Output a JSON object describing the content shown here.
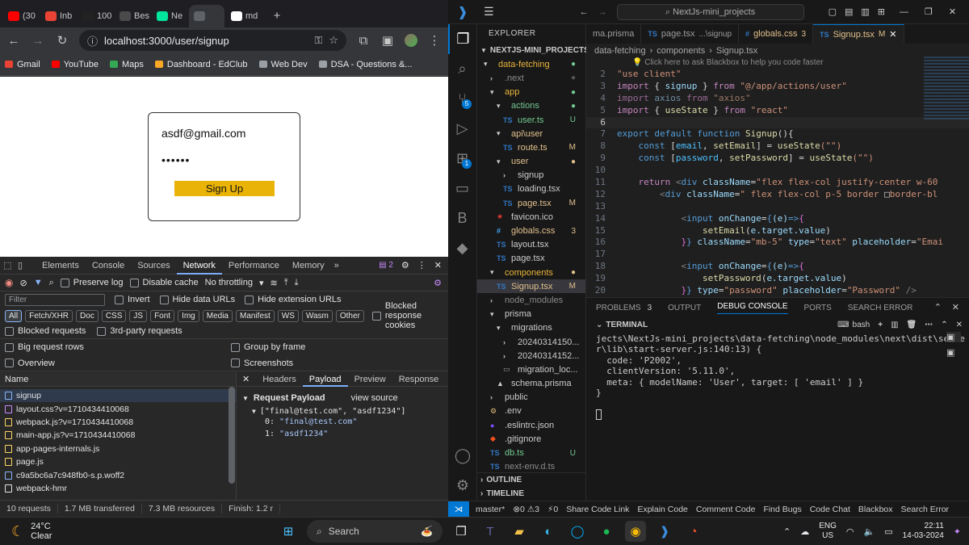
{
  "browser": {
    "tabs": [
      {
        "label": "(30",
        "icon": "youtube-icon",
        "color": "#ff0000"
      },
      {
        "label": "Inb",
        "icon": "gmail-icon",
        "color": "#ea4335"
      },
      {
        "label": "100",
        "icon": "triangle-icon",
        "color": "#222222"
      },
      {
        "label": "Bes",
        "icon": "a-logo-icon",
        "color": "#4a4a4a"
      },
      {
        "label": "Ne",
        "icon": "neon-icon",
        "color": "#00e599"
      },
      {
        "label": "",
        "icon": "globe-icon",
        "color": "#5f6368"
      },
      {
        "label": "md",
        "icon": "github-icon",
        "color": "#ffffff"
      }
    ],
    "new_tab": "+",
    "url": "localhost:3000/user/signup",
    "bookmarks": [
      {
        "label": "Gmail",
        "color": "#ea4335"
      },
      {
        "label": "YouTube",
        "color": "#ff0000"
      },
      {
        "label": "Maps",
        "color": "#34a853"
      },
      {
        "label": "Dashboard - EdClub",
        "color": "#f9a825"
      },
      {
        "label": "Web Dev",
        "color": "#9aa0a6"
      },
      {
        "label": "DSA - Questions &...",
        "color": "#9aa0a6"
      }
    ]
  },
  "page": {
    "email_value": "asdf@gmail.com",
    "password_value": "••••••",
    "signup_label": "Sign Up",
    "accent": "#eab308"
  },
  "devtools": {
    "tabs": [
      "Elements",
      "Console",
      "Sources",
      "Network",
      "Performance",
      "Memory"
    ],
    "issues_count": "2",
    "preserve_log": "Preserve log",
    "disable_cache": "Disable cache",
    "throttling": "No throttling",
    "filter_placeholder": "Filter",
    "invert": "Invert",
    "hide_data_urls": "Hide data URLs",
    "hide_ext_urls": "Hide extension URLs",
    "chips": [
      "All",
      "Fetch/XHR",
      "Doc",
      "CSS",
      "JS",
      "Font",
      "Img",
      "Media",
      "Manifest",
      "WS",
      "Wasm",
      "Other"
    ],
    "blocked_cookies": "Blocked response cookies",
    "blocked_requests": "Blocked requests",
    "third_party": "3rd-party requests",
    "big_rows": "Big request rows",
    "group_frame": "Group by frame",
    "overview": "Overview",
    "screenshots": "Screenshots",
    "name_header": "Name",
    "requests": [
      "signup",
      "layout.css?v=1710434410068",
      "webpack.js?v=1710434410068",
      "main-app.js?v=1710434410068",
      "app-pages-internals.js",
      "page.js",
      "c9a5bc6a7c948fb0-s.p.woff2",
      "webpack-hmr"
    ],
    "detail_tabs": [
      "Headers",
      "Payload",
      "Preview",
      "Response"
    ],
    "payload_title": "Request Payload",
    "view_source": "view source",
    "payload_array": "[\"final@test.com\", \"asdf1234\"]",
    "payload_items": [
      {
        "k": "0:",
        "v": "\"final@test.com\""
      },
      {
        "k": "1:",
        "v": "\"asdf1234\""
      }
    ],
    "status": [
      "10 requests",
      "1.7 MB transferred",
      "7.3 MB resources",
      "Finish: 1.2 r"
    ]
  },
  "vscode": {
    "search": "NextJs-mini_projects",
    "explorer_title": "EXPLORER",
    "project": "NEXTJS-MINI_PROJECTS",
    "tree": [
      {
        "d": 1,
        "t": "fo",
        "n": "data-fetching",
        "c": "#e8b43a",
        "s": "●",
        "sc": "#73c991"
      },
      {
        "d": 2,
        "t": "fc",
        "n": ".next",
        "c": "#8a8a8a",
        "s": "●",
        "sc": "#555"
      },
      {
        "d": 2,
        "t": "fo",
        "n": "app",
        "c": "#e8b43a",
        "s": "●",
        "sc": "#73c991"
      },
      {
        "d": 3,
        "t": "fo",
        "n": "actions",
        "c": "#73c991",
        "s": "●",
        "sc": "#73c991"
      },
      {
        "d": 4,
        "t": "ts",
        "n": "user.ts",
        "c": "#73c991",
        "s": "U",
        "sc": "#73c991"
      },
      {
        "d": 3,
        "t": "fo",
        "n": "api\\user",
        "c": "#e2c08d",
        "s": "",
        "sc": ""
      },
      {
        "d": 4,
        "t": "ts",
        "n": "route.ts",
        "c": "#e2c08d",
        "s": "M",
        "sc": "#e2c08d"
      },
      {
        "d": 3,
        "t": "fo",
        "n": "user",
        "c": "#e2c08d",
        "s": "●",
        "sc": "#e2c08d"
      },
      {
        "d": 4,
        "t": "fc",
        "n": "signup",
        "c": "#cccccc",
        "s": "",
        "sc": ""
      },
      {
        "d": 4,
        "t": "tsx",
        "n": "loading.tsx",
        "c": "#cccccc",
        "s": "",
        "sc": ""
      },
      {
        "d": 4,
        "t": "tsx",
        "n": "page.tsx",
        "c": "#e2c08d",
        "s": "M",
        "sc": "#e2c08d"
      },
      {
        "d": 3,
        "t": "ico",
        "n": "favicon.ico",
        "c": "#cccccc",
        "s": "",
        "sc": ""
      },
      {
        "d": 3,
        "t": "css",
        "n": "globals.css",
        "c": "#e2c08d",
        "s": "3",
        "sc": "#e2c08d"
      },
      {
        "d": 3,
        "t": "tsx",
        "n": "layout.tsx",
        "c": "#cccccc",
        "s": "",
        "sc": ""
      },
      {
        "d": 3,
        "t": "tsx",
        "n": "page.tsx",
        "c": "#cccccc",
        "s": "",
        "sc": ""
      },
      {
        "d": 2,
        "t": "fo",
        "n": "components",
        "c": "#e8b43a",
        "s": "●",
        "sc": "#e2c08d"
      },
      {
        "d": 3,
        "t": "tsx",
        "n": "Signup.tsx",
        "c": "#e2c08d",
        "s": "M",
        "sc": "#e2c08d",
        "sel": true
      },
      {
        "d": 2,
        "t": "fc",
        "n": "node_modules",
        "c": "#8a8a8a",
        "s": "",
        "sc": ""
      },
      {
        "d": 2,
        "t": "fo",
        "n": "prisma",
        "c": "#cccccc",
        "s": "",
        "sc": ""
      },
      {
        "d": 3,
        "t": "fo",
        "n": "migrations",
        "c": "#cccccc",
        "s": "",
        "sc": ""
      },
      {
        "d": 4,
        "t": "fc",
        "n": "20240314150...",
        "c": "#cccccc",
        "s": "",
        "sc": ""
      },
      {
        "d": 4,
        "t": "fc",
        "n": "20240314152...",
        "c": "#cccccc",
        "s": "",
        "sc": ""
      },
      {
        "d": 4,
        "t": "f",
        "n": "migration_loc...",
        "c": "#cccccc",
        "s": "",
        "sc": ""
      },
      {
        "d": 3,
        "t": "prisma",
        "n": "schema.prisma",
        "c": "#cccccc",
        "s": "",
        "sc": ""
      },
      {
        "d": 2,
        "t": "fc",
        "n": "public",
        "c": "#cccccc",
        "s": "",
        "sc": ""
      },
      {
        "d": 2,
        "t": "env",
        "n": ".env",
        "c": "#cccccc",
        "s": "",
        "sc": ""
      },
      {
        "d": 2,
        "t": "json",
        "n": ".eslintrc.json",
        "c": "#cccccc",
        "s": "",
        "sc": ""
      },
      {
        "d": 2,
        "t": "git",
        "n": ".gitignore",
        "c": "#cccccc",
        "s": "",
        "sc": ""
      },
      {
        "d": 2,
        "t": "ts",
        "n": "db.ts",
        "c": "#73c991",
        "s": "U",
        "sc": "#73c991"
      },
      {
        "d": 2,
        "t": "ts",
        "n": "next-env.d.ts",
        "c": "#8a8a8a",
        "s": "",
        "sc": ""
      }
    ],
    "outline": "OUTLINE",
    "timeline": "TIMELINE",
    "tabs": [
      {
        "n": "ma.prisma",
        "icon": "",
        "c": "#9d9d9d"
      },
      {
        "n": "page.tsx",
        "extra": "...\\signup",
        "icon": "TS",
        "c": "#9d9d9d"
      },
      {
        "n": "globals.css",
        "extra": "3",
        "icon": "#",
        "c": "#e2c08d"
      },
      {
        "n": "Signup.tsx",
        "extra": "M",
        "icon": "TS",
        "c": "#e2c08d",
        "active": true
      }
    ],
    "breadcrumb": [
      "data-fetching",
      "components",
      "Signup.tsx"
    ],
    "hint": "Click here to ask Blackbox to help you code faster",
    "code": [
      [
        [
          "\"use client\"",
          "#ce9178"
        ]
      ],
      [
        [
          "import ",
          "#c586c0"
        ],
        [
          "{ ",
          "#d4d4d4"
        ],
        [
          "signup",
          "#9cdcfe"
        ],
        [
          " } ",
          "#d4d4d4"
        ],
        [
          "from ",
          "#c586c0"
        ],
        [
          "\"@/app/actions/user\"",
          "#ce9178"
        ]
      ],
      [
        [
          "import ",
          "#9a6b96"
        ],
        [
          "axios ",
          "#6f8ea3"
        ],
        [
          "from ",
          "#9a6b96"
        ],
        [
          "\"axios\"",
          "#9a7866"
        ]
      ],
      [
        [
          "import ",
          "#c586c0"
        ],
        [
          "{ ",
          "#d4d4d4"
        ],
        [
          "useState",
          "#dcdcaa"
        ],
        [
          " } ",
          "#d4d4d4"
        ],
        [
          "from ",
          "#c586c0"
        ],
        [
          "\"react\"",
          "#ce9178"
        ]
      ],
      [
        [
          "",
          ""
        ]
      ],
      [
        [
          "export default function ",
          "#569cd6"
        ],
        [
          "Signup",
          "#dcdcaa"
        ],
        [
          "(){",
          "#d4d4d4"
        ]
      ],
      [
        [
          "    const ",
          "#569cd6"
        ],
        [
          "[",
          "#d4d4d4"
        ],
        [
          "email",
          "#4fc1ff"
        ],
        [
          ", ",
          "#d4d4d4"
        ],
        [
          "setEmail",
          "#dcdcaa"
        ],
        [
          "] = ",
          "#d4d4d4"
        ],
        [
          "useState",
          "#dcdcaa"
        ],
        [
          "(\"\")",
          "#ce9178"
        ]
      ],
      [
        [
          "    const ",
          "#569cd6"
        ],
        [
          "[",
          "#d4d4d4"
        ],
        [
          "password",
          "#4fc1ff"
        ],
        [
          ", ",
          "#d4d4d4"
        ],
        [
          "setPassword",
          "#dcdcaa"
        ],
        [
          "] = ",
          "#d4d4d4"
        ],
        [
          "useState",
          "#dcdcaa"
        ],
        [
          "(\"\")",
          "#ce9178"
        ]
      ],
      [
        [
          "",
          ""
        ]
      ],
      [
        [
          "    return ",
          "#c586c0"
        ],
        [
          "<",
          "#808080"
        ],
        [
          "div ",
          "#569cd6"
        ],
        [
          "className",
          "#9cdcfe"
        ],
        [
          "=",
          "#d4d4d4"
        ],
        [
          "\"flex flex-col justify-center w-60",
          "#ce9178"
        ]
      ],
      [
        [
          "        <",
          "#808080"
        ],
        [
          "div ",
          "#569cd6"
        ],
        [
          "className",
          "#9cdcfe"
        ],
        [
          "=",
          "#d4d4d4"
        ],
        [
          "\" flex flex-col p-5 border ",
          "#ce9178"
        ],
        [
          "□",
          "#d4d4d4"
        ],
        [
          "border-bl",
          "#ce9178"
        ]
      ],
      [
        [
          "",
          ""
        ]
      ],
      [
        [
          "            <",
          "#808080"
        ],
        [
          "input ",
          "#569cd6"
        ],
        [
          "onChange",
          "#9cdcfe"
        ],
        [
          "=",
          "#d4d4d4"
        ],
        [
          "{",
          "#569cd6"
        ],
        [
          "(e)",
          "#9cdcfe"
        ],
        [
          "=>",
          "#569cd6"
        ],
        [
          "{",
          "#da70d6"
        ]
      ],
      [
        [
          "                setEmail",
          "#dcdcaa"
        ],
        [
          "(",
          "#d4d4d4"
        ],
        [
          "e.target.value",
          "#9cdcfe"
        ],
        [
          ")",
          "#d4d4d4"
        ]
      ],
      [
        [
          "            }",
          "#da70d6"
        ],
        [
          "} ",
          "#569cd6"
        ],
        [
          "className",
          "#9cdcfe"
        ],
        [
          "=",
          "#d4d4d4"
        ],
        [
          "\"mb-5\" ",
          "#ce9178"
        ],
        [
          "type",
          "#9cdcfe"
        ],
        [
          "=",
          "#d4d4d4"
        ],
        [
          "\"text\" ",
          "#ce9178"
        ],
        [
          "placeholder",
          "#9cdcfe"
        ],
        [
          "=",
          "#d4d4d4"
        ],
        [
          "\"Emai",
          "#ce9178"
        ]
      ],
      [
        [
          "",
          ""
        ]
      ],
      [
        [
          "            <",
          "#808080"
        ],
        [
          "input ",
          "#569cd6"
        ],
        [
          "onChange",
          "#9cdcfe"
        ],
        [
          "=",
          "#d4d4d4"
        ],
        [
          "{",
          "#569cd6"
        ],
        [
          "(e)",
          "#9cdcfe"
        ],
        [
          "=>",
          "#569cd6"
        ],
        [
          "{",
          "#da70d6"
        ]
      ],
      [
        [
          "                setPassword",
          "#dcdcaa"
        ],
        [
          "(",
          "#d4d4d4"
        ],
        [
          "e.target.value",
          "#9cdcfe"
        ],
        [
          ")",
          "#d4d4d4"
        ]
      ],
      [
        [
          "            }",
          "#da70d6"
        ],
        [
          "} ",
          "#569cd6"
        ],
        [
          "type",
          "#9cdcfe"
        ],
        [
          "=",
          "#d4d4d4"
        ],
        [
          "\"password\" ",
          "#ce9178"
        ],
        [
          "placeholder",
          "#9cdcfe"
        ],
        [
          "=",
          "#d4d4d4"
        ],
        [
          "\"Password\" ",
          "#ce9178"
        ],
        [
          "/>",
          "#808080"
        ]
      ]
    ],
    "panel_tabs": [
      {
        "n": "PROBLEMS",
        "b": "3"
      },
      {
        "n": "OUTPUT"
      },
      {
        "n": "DEBUG CONSOLE",
        "active": true
      },
      {
        "n": "PORTS"
      },
      {
        "n": "SEARCH ERROR"
      }
    ],
    "terminal_title": "TERMINAL",
    "shell": "bash",
    "terminal": [
      "jects\\NextJs-mini_projects\\data-fetching\\node_modules\\next\\dist\\serve",
      "r\\lib\\start-server.js:140:13) {",
      "  code: 'P2002',",
      "  clientVersion: '5.11.0',",
      "  meta: { modelName: 'User', target: [ 'email' ] }",
      "}",
      ""
    ],
    "status": [
      "master*",
      "⊗0 ⚠3",
      "⚡0",
      "Share Code Link",
      "Explain Code",
      "Comment Code",
      "Find Bugs",
      "Code Chat",
      "Blackbox",
      "Search Error"
    ]
  },
  "taskbar": {
    "temp": "24°C",
    "weather": "Clear",
    "search": "Search",
    "lang1": "ENG",
    "lang2": "US",
    "time": "22:11",
    "date": "14-03-2024"
  }
}
